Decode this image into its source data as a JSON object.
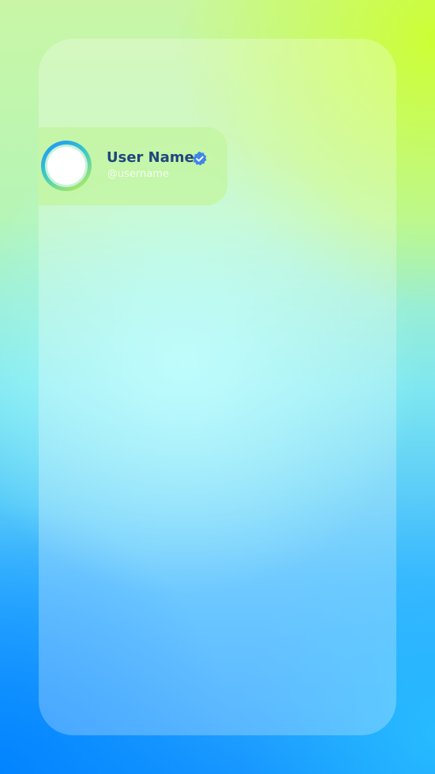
{
  "profile": {
    "display_name": "User Name",
    "handle": "@username",
    "badge_icon": "verified-badge-icon"
  },
  "colors": {
    "name_text": "#21467d",
    "badge_fill": "#3f86e6",
    "handle_text": "#ffffff"
  }
}
